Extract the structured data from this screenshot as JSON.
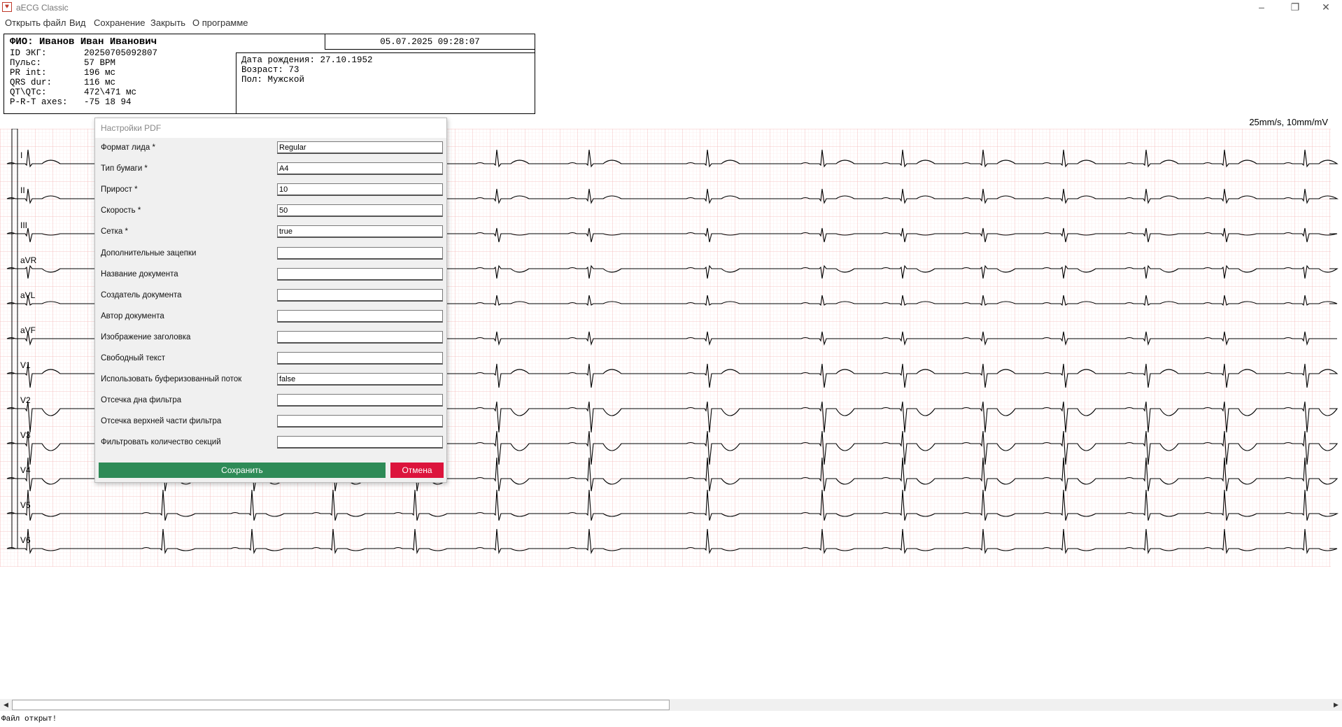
{
  "window": {
    "title": "aECG Classic"
  },
  "menu": [
    "Открыть файл",
    "Вид",
    "Сохранение",
    "Закрыть",
    "О программе"
  ],
  "header": {
    "name": "ФИО: Иванов Иван Иванович",
    "datetime": "05.07.2025 09:28:07",
    "rows": [
      {
        "k": "ID ЭКГ:",
        "v": "20250705092807"
      },
      {
        "k": "Пульс:",
        "v": "57 BPM"
      },
      {
        "k": "PR int:",
        "v": "196 мс"
      },
      {
        "k": "QRS dur:",
        "v": "116 мс"
      },
      {
        "k": "QT\\QTc:",
        "v": "472\\471 мс"
      },
      {
        "k": "P-R-T axes:",
        "v": "-75 18 94"
      }
    ],
    "patient": {
      "birth": "Дата рождения: 27.10.1952",
      "age": "Возраст: 73",
      "sex": "Пол: Мужской"
    }
  },
  "ecg": {
    "scale": "25mm/s, 10mm/mV",
    "leads": [
      "I",
      "II",
      "III",
      "aVR",
      "aVL",
      "aVF",
      "V1",
      "V2",
      "V3",
      "V4",
      "V5",
      "V6"
    ],
    "colors": {
      "grid_major": "#f4b6b6",
      "grid_minor": "#fbe1e1",
      "trace": "#000000"
    }
  },
  "dialog": {
    "title": "Настройки PDF",
    "fields": [
      {
        "label": "Формат лида *",
        "value": "Regular"
      },
      {
        "label": "Тип бумаги *",
        "value": "A4"
      },
      {
        "label": "Прирост *",
        "value": "10"
      },
      {
        "label": "Скорость *",
        "value": "50"
      },
      {
        "label": "Сетка *",
        "value": "true"
      },
      {
        "label": "Дополнительные зацепки",
        "value": ""
      },
      {
        "label": "Название документа",
        "value": ""
      },
      {
        "label": "Создатель документа",
        "value": ""
      },
      {
        "label": "Автор документа",
        "value": ""
      },
      {
        "label": "Изображение заголовка",
        "value": ""
      },
      {
        "label": "Свободный текст",
        "value": ""
      },
      {
        "label": "Использовать буферизованный поток",
        "value": "false"
      },
      {
        "label": "Отсечка дна фильтра",
        "value": ""
      },
      {
        "label": "Отсечка верхней части фильтра",
        "value": ""
      },
      {
        "label": "Фильтровать количество секций",
        "value": ""
      }
    ],
    "save_label": "Сохранить",
    "cancel_label": "Отмена",
    "colors": {
      "save": "#2e8b57",
      "cancel": "#dc143c"
    }
  },
  "status": "Файл открыт!"
}
